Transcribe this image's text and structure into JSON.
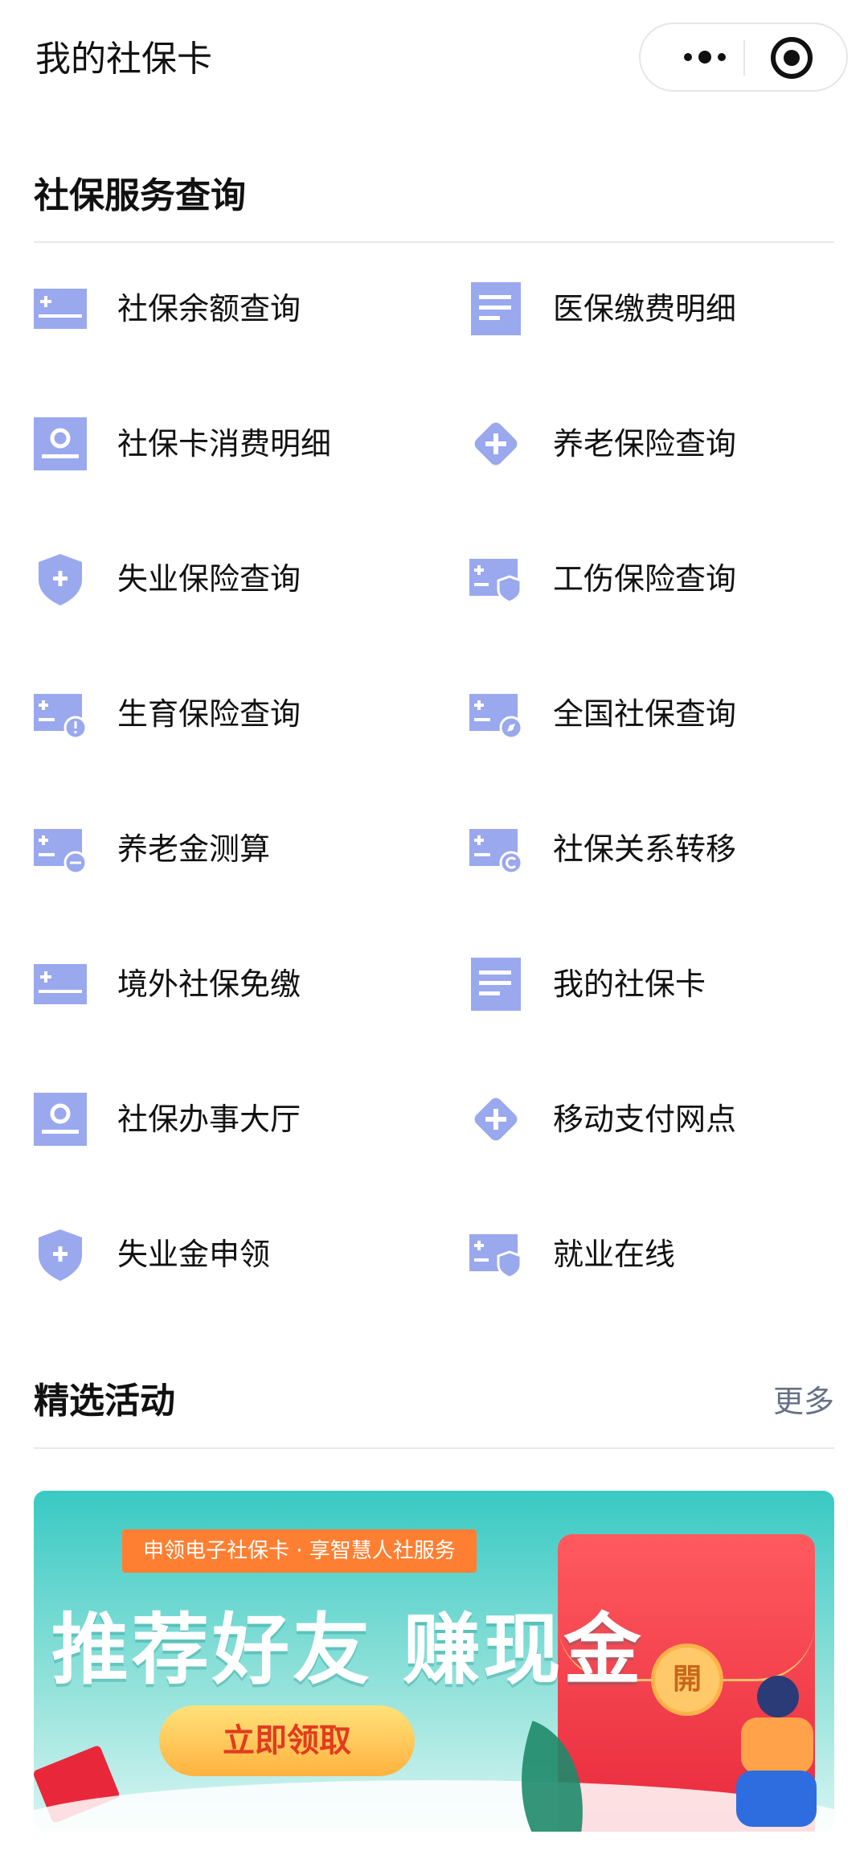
{
  "header": {
    "title": "我的社保卡",
    "more_icon": "more-dots-icon",
    "close_icon": "target-close-icon"
  },
  "services": {
    "title": "社保服务查询",
    "items": [
      {
        "label": "社保余额查询",
        "icon": "card-plus-icon"
      },
      {
        "label": "医保缴费明细",
        "icon": "document-lines-icon"
      },
      {
        "label": "社保卡消费明细",
        "icon": "id-card-icon"
      },
      {
        "label": "养老保险查询",
        "icon": "diamond-plus-icon"
      },
      {
        "label": "失业保险查询",
        "icon": "shield-plus-icon"
      },
      {
        "label": "工伤保险查询",
        "icon": "card-shield-icon"
      },
      {
        "label": "生育保险查询",
        "icon": "card-alert-icon"
      },
      {
        "label": "全国社保查询",
        "icon": "card-compass-icon"
      },
      {
        "label": "养老金测算",
        "icon": "card-minus-icon"
      },
      {
        "label": "社保关系转移",
        "icon": "card-copyright-icon"
      },
      {
        "label": "境外社保免缴",
        "icon": "card-plus-icon"
      },
      {
        "label": "我的社保卡",
        "icon": "document-lines-icon"
      },
      {
        "label": "社保办事大厅",
        "icon": "id-card-icon"
      },
      {
        "label": "移动支付网点",
        "icon": "diamond-plus-icon"
      },
      {
        "label": "失业金申领",
        "icon": "shield-plus-icon"
      },
      {
        "label": "就业在线",
        "icon": "card-shield-icon"
      }
    ]
  },
  "activities": {
    "title": "精选活动",
    "more_label": "更多"
  },
  "banner": {
    "ribbon": "申领电子社保卡 · 享智慧人社服务",
    "headline": "推荐好友 赚现金",
    "cta_label": "立即领取",
    "seal_text": "開"
  },
  "colors": {
    "icon": "#9aa8ee",
    "banner_bg": "#39c9c4",
    "cta_text": "#e23b1f"
  }
}
